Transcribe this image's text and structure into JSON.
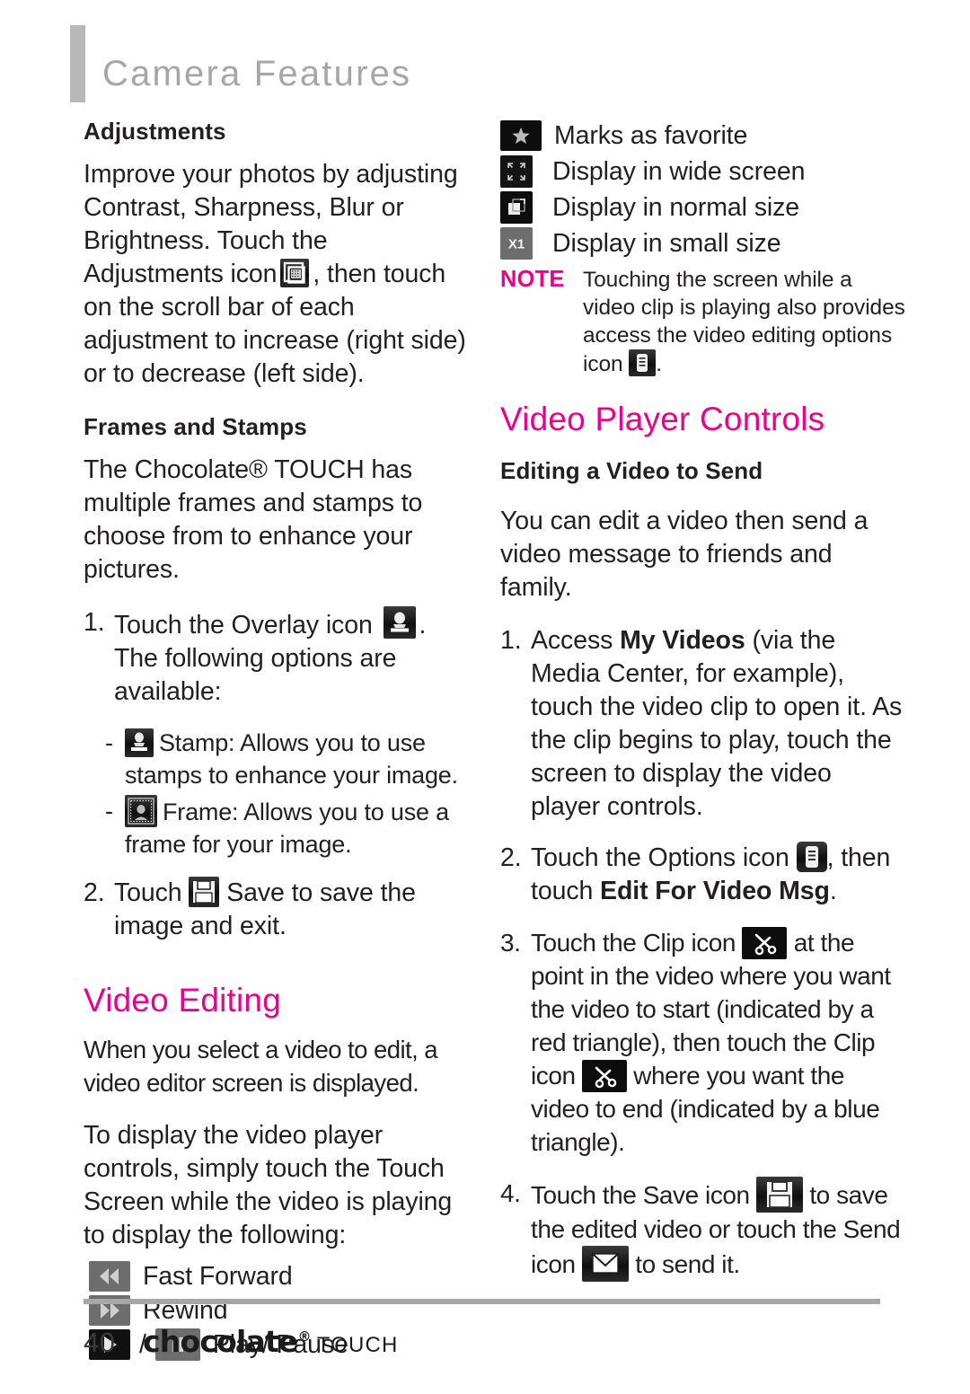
{
  "header": {
    "title": "Camera Features"
  },
  "left": {
    "adjustments": {
      "heading": "Adjustments",
      "text_1": "Improve your photos by adjusting Contrast, Sharpness, Blur or Brightness. Touch the Adjustments icon",
      "text_2": ", then touch on the scroll bar of each adjustment to increase (right side) or to decrease (left side).",
      "icon": "adjustments-icon"
    },
    "frames": {
      "heading": "Frames and Stamps",
      "intro": "The Chocolate® TOUCH has multiple frames and stamps to choose from to enhance your pictures.",
      "step1_num": "1.",
      "step1_a": "Touch the Overlay icon",
      "step1_b": ". The following options are available:",
      "step1_icon": "overlay-icon",
      "bullets": [
        {
          "dash": "-",
          "icon": "stamp-icon",
          "text": "Stamp: Allows you to use stamps to enhance your image."
        },
        {
          "dash": "-",
          "icon": "frame-icon",
          "text": "Frame: Allows you to use a frame for your image."
        }
      ],
      "step2_num": "2.",
      "step2_a": "Touch",
      "step2_b": "Save to save the image and exit.",
      "step2_icon": "save-floppy-icon"
    },
    "video_editing": {
      "heading": "Video Editing",
      "para_1": "When you select a video to edit, a video editor screen is displayed.",
      "para_2": "To display the video player controls, simply touch the Touch Screen while the video is playing to display the following:",
      "controls": [
        {
          "icon": "fast-forward-icon",
          "label": "Fast Forward"
        },
        {
          "icon": "rewind-icon",
          "label": "Rewind"
        },
        {
          "icon": "play-icon",
          "separator": "/",
          "icon2": "pause-icon",
          "label": "Play/ Pause"
        }
      ]
    }
  },
  "right": {
    "icon_list": [
      {
        "icon": "star-icon",
        "label": "Marks as favorite"
      },
      {
        "icon": "wide-screen-icon",
        "label": "Display in wide screen"
      },
      {
        "icon": "normal-size-icon",
        "label": "Display in normal size"
      },
      {
        "icon": "small-size-icon",
        "label": "Display in small size"
      }
    ],
    "note": {
      "label": "NOTE",
      "text": "Touching the screen while a video clip is playing also provides access the video editing options icon",
      "icon": "options-icon",
      "trailing": "."
    },
    "video_player_controls": {
      "heading": "Video Player Controls",
      "sub_heading": "Editing a Video to Send",
      "intro": "You can edit a video then send a video message to friends and family.",
      "steps": [
        {
          "num": "1.",
          "a": "Access ",
          "bold": "My Videos",
          "b": " (via the Media Center, for example), touch the video clip to open it. As the clip begins to play, touch the screen to display the video player controls."
        },
        {
          "num": "2.",
          "a": "Touch the Options icon",
          "icon": "options-icon",
          "b": ", then touch ",
          "bold": "Edit For Video Msg",
          "c": "."
        },
        {
          "num": "3.",
          "a": "Touch the Clip icon",
          "icon": "clip-scissors-icon",
          "b": "at the point in the video where you want the video to start (indicated by a red triangle), then touch the Clip icon",
          "icon2": "clip-scissors-icon",
          "c": "where you want the video to end (indicated by a blue triangle)."
        },
        {
          "num": "4.",
          "a": "Touch the Save icon",
          "icon": "save-floppy-icon",
          "b": "to save the edited video or touch the Send icon",
          "icon2": "send-envelope-icon",
          "c": "to send it."
        }
      ]
    }
  },
  "footer": {
    "page_number": "40",
    "logo_name": "chocolate",
    "logo_reg": "®",
    "logo_suffix": "TOUCH"
  },
  "colors": {
    "magenta": "#ec008c",
    "header_gray": "#a6a6a6",
    "bar_gray": "#b8b8b8",
    "body_ink": "#231f20"
  }
}
